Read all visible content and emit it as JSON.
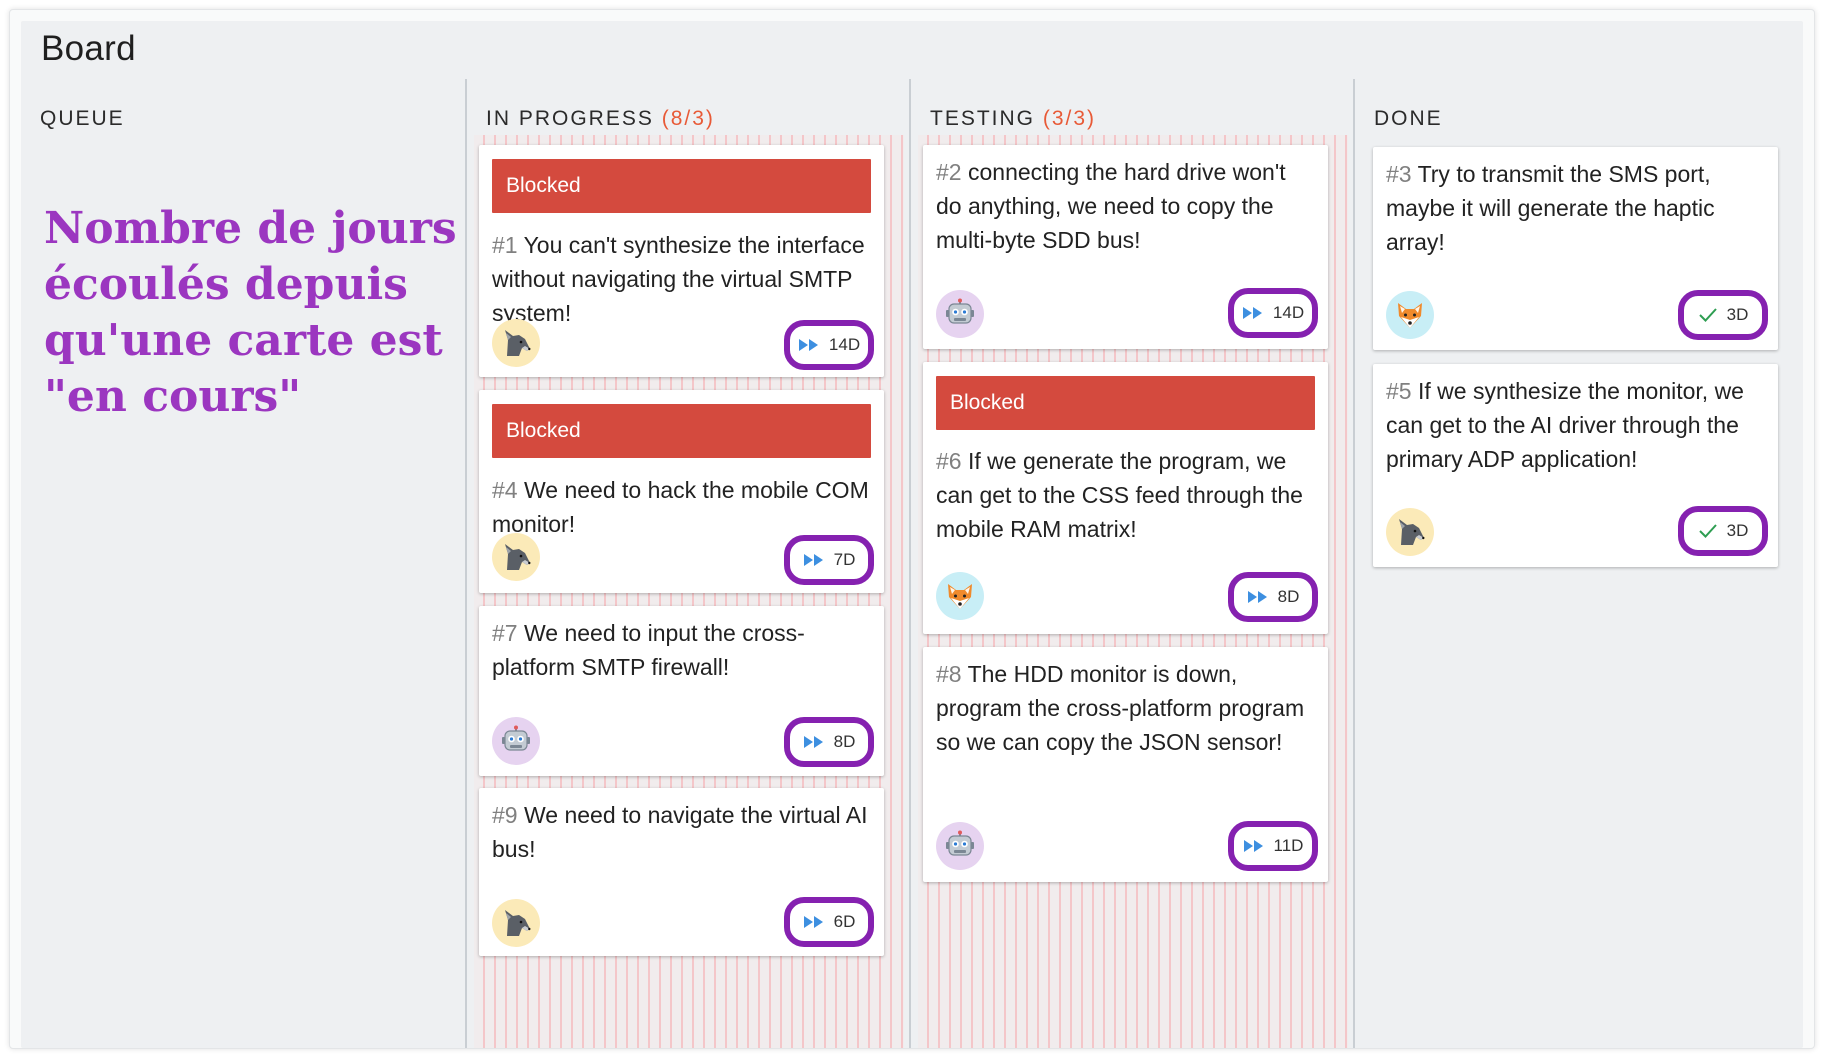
{
  "board": {
    "title": "Board"
  },
  "columns": [
    {
      "title": "QUEUE",
      "wip": ""
    },
    {
      "title": "IN PROGRESS",
      "wip": "(8/3)"
    },
    {
      "title": "TESTING",
      "wip": "(3/3)"
    },
    {
      "title": "DONE",
      "wip": ""
    }
  ],
  "annotation": {
    "text": "Nombre de jours écoulés depuis qu'une carte est \"en cours\""
  },
  "cards": [
    {
      "id": "#1",
      "text": "You can't synthesize the interface without navigating the virtual SMTP system!",
      "blocked": "Blocked",
      "avatar": "wolf-icon",
      "status_icon": "fast-forward-icon",
      "days": "14D"
    },
    {
      "id": "#4",
      "text": "We need to hack the mobile COM monitor!",
      "blocked": "Blocked",
      "avatar": "wolf-icon",
      "status_icon": "fast-forward-icon",
      "days": "7D"
    },
    {
      "id": "#7",
      "text": "We need to input the cross-platform SMTP firewall!",
      "avatar": "robot-icon",
      "status_icon": "fast-forward-icon",
      "days": "8D"
    },
    {
      "id": "#9",
      "text": "We need to navigate the virtual AI bus!",
      "avatar": "wolf-icon",
      "status_icon": "fast-forward-icon",
      "days": "6D"
    },
    {
      "id": "#2",
      "text": "connecting the hard drive won't do anything, we need to copy the multi-byte SDD bus!",
      "avatar": "robot-icon",
      "status_icon": "fast-forward-icon",
      "days": "14D"
    },
    {
      "id": "#6",
      "text": "If we generate the program, we can get to the CSS feed through the mobile RAM matrix!",
      "blocked": "Blocked",
      "avatar": "fox-icon",
      "status_icon": "fast-forward-icon",
      "days": "8D"
    },
    {
      "id": "#8",
      "text": "The HDD monitor is down, program the cross-platform program so we can copy the JSON sensor!",
      "avatar": "robot-icon",
      "status_icon": "fast-forward-icon",
      "days": "11D"
    },
    {
      "id": "#3",
      "text": "Try to transmit the SMS port, maybe it will generate the haptic array!",
      "avatar": "fox-icon",
      "status_icon": "check-icon",
      "days": "3D"
    },
    {
      "id": "#5",
      "text": "If we synthesize the monitor, we can get to the AI driver through the primary ADP application!",
      "avatar": "wolf-icon",
      "status_icon": "check-icon",
      "days": "3D"
    }
  ],
  "colors": {
    "blocked": "#d44a3e",
    "wip_limit": "#e85a37",
    "highlight": "#8521b0",
    "annotation": "#9b36c0",
    "in_progress_icon": "#3d8fe0",
    "done_icon": "#2e9e52"
  }
}
